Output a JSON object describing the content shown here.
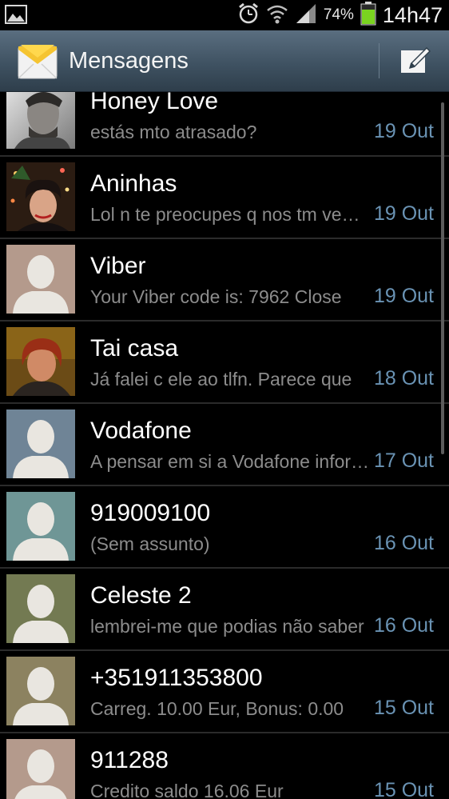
{
  "status_bar": {
    "icons": [
      "image-icon",
      "alarm-icon",
      "wifi-icon",
      "signal-icon",
      "battery-icon"
    ],
    "battery": "74%",
    "time": "14h47"
  },
  "action_bar": {
    "title": "Mensagens",
    "icon": "envelope-icon",
    "compose_icon": "compose-icon"
  },
  "threads": [
    {
      "name": "Honey Love",
      "snippet": "estás mto atrasado?",
      "date": "19 Out",
      "avatar": "photo-man"
    },
    {
      "name": "Aninhas",
      "snippet": "Lol n te preocupes q nos tm vemos",
      "date": "19 Out",
      "avatar": "photo-woman-christmas"
    },
    {
      "name": "Viber",
      "snippet": "Your Viber code is: 7962 Close",
      "date": "19 Out",
      "avatar": "placeholder",
      "avatar_bg": "#b49a8c"
    },
    {
      "name": "Tai casa",
      "snippet": "Já falei c ele ao tlfn. Parece que",
      "date": "18 Out",
      "avatar": "photo-woman"
    },
    {
      "name": "Vodafone",
      "snippet": "A pensar em si a Vodafone informa",
      "date": "17 Out",
      "avatar": "placeholder",
      "avatar_bg": "#6f8496"
    },
    {
      "name": "919009100",
      "snippet": "(Sem assunto)",
      "date": "16 Out",
      "avatar": "placeholder",
      "avatar_bg": "#6f9696"
    },
    {
      "name": "Celeste 2",
      "snippet": "lembrei-me que podias não saber",
      "date": "16 Out",
      "avatar": "placeholder",
      "avatar_bg": "#737a52"
    },
    {
      "name": "+351911353800",
      "snippet": "Carreg. 10.00 Eur, Bonus: 0.00",
      "date": "15 Out",
      "avatar": "placeholder",
      "avatar_bg": "#8c8260"
    },
    {
      "name": "911288",
      "snippet": "Credito saldo 16.06 Eur",
      "date": "15 Out",
      "avatar": "placeholder",
      "avatar_bg": "#b49a8c"
    }
  ],
  "colors": {
    "action_bar": "#3f5262",
    "date_text": "#6a93b4",
    "snippet_text": "#8c8c8c"
  }
}
